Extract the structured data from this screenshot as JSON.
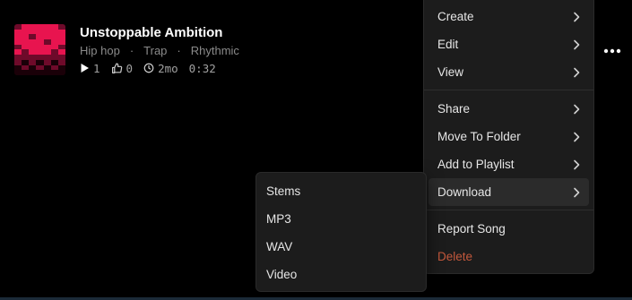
{
  "song": {
    "title": "Unstoppable Ambition",
    "tags": [
      "Hip hop",
      "Trap",
      "Rhythmic"
    ],
    "tag_separator": "·",
    "stats": {
      "plays": "1",
      "likes": "0",
      "age": "2mo",
      "duration": "0:32"
    },
    "cover_colors": {
      "primary": "#e8144f",
      "secondary": "#6e0a2a",
      "dark": "#1a0008"
    }
  },
  "menu": {
    "items": [
      {
        "label": "Create",
        "has_submenu": true
      },
      {
        "label": "Edit",
        "has_submenu": true
      },
      {
        "label": "View",
        "has_submenu": true
      },
      {
        "label": "Share",
        "has_submenu": true
      },
      {
        "label": "Move To Folder",
        "has_submenu": true
      },
      {
        "label": "Add to Playlist",
        "has_submenu": true
      },
      {
        "label": "Download",
        "has_submenu": true,
        "active": true
      },
      {
        "label": "Report Song",
        "has_submenu": false
      },
      {
        "label": "Delete",
        "has_submenu": false,
        "danger": true
      }
    ]
  },
  "download_submenu": {
    "items": [
      "Stems",
      "MP3",
      "WAV",
      "Video"
    ]
  },
  "colors": {
    "background": "#000000",
    "menu_bg": "#1c1c1c",
    "danger": "#c4583c",
    "text_muted": "#8a8a8a"
  },
  "icons": {
    "play": "play-icon",
    "like": "thumbs-up-icon",
    "age": "clock-icon",
    "more": "more-horizontal-icon",
    "submenu": "chevron-right-icon"
  }
}
